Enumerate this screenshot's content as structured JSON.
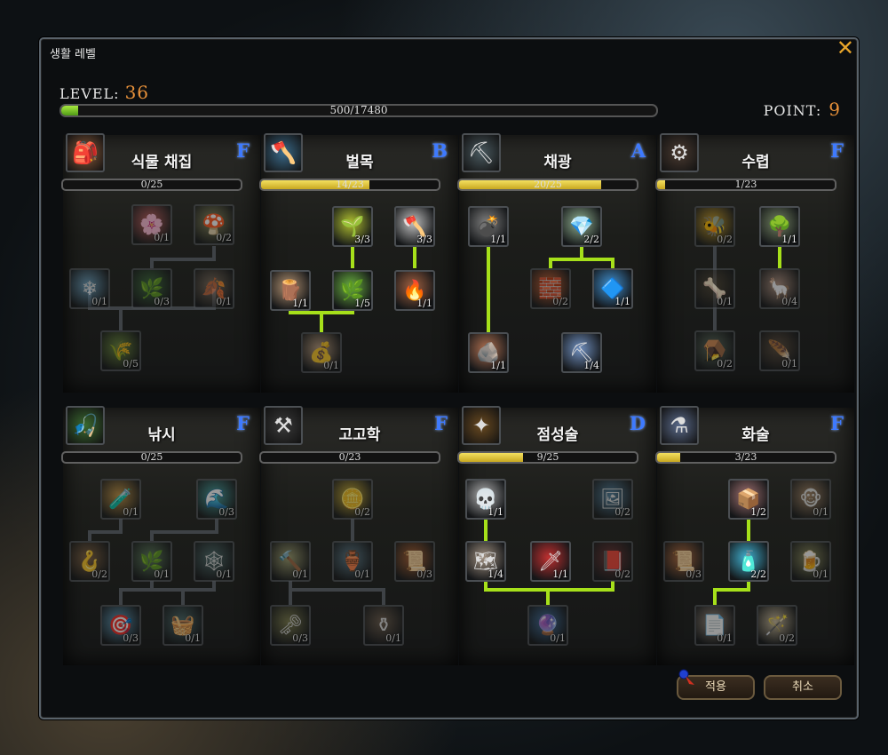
{
  "window": {
    "title": "생활 레벨",
    "close_label": "✕"
  },
  "level": {
    "label": "LEVEL:",
    "value": "36"
  },
  "point": {
    "label": "POINT:",
    "value": "9"
  },
  "xp": {
    "text": "500/17480",
    "fraction": 0.0286
  },
  "buttons": {
    "apply": "적용",
    "cancel": "취소"
  },
  "panels": [
    {
      "name": "식물 채집",
      "grade": "F",
      "progress": "0/25",
      "ratio": 0.0,
      "icon": "herb-bag-icon",
      "emoji": "🎒",
      "accent": "#8a5a3a"
    },
    {
      "name": "벌목",
      "grade": "B",
      "progress": "14/23",
      "ratio": 0.6087,
      "icon": "axe-icon",
      "emoji": "🪓",
      "accent": "#3a6a8a"
    },
    {
      "name": "채광",
      "grade": "A",
      "progress": "20/25",
      "ratio": 0.8,
      "icon": "pickaxe-icon",
      "emoji": "⛏",
      "accent": "#4a5a60"
    },
    {
      "name": "수렵",
      "grade": "F",
      "progress": "1/23",
      "ratio": 0.0435,
      "icon": "trap-icon",
      "emoji": "⚙",
      "accent": "#4a3a30"
    },
    {
      "name": "낚시",
      "grade": "F",
      "progress": "0/25",
      "ratio": 0.0,
      "icon": "fishing-rod-icon",
      "emoji": "🎣",
      "accent": "#3a6a30"
    },
    {
      "name": "고고학",
      "grade": "F",
      "progress": "0/23",
      "ratio": 0.0,
      "icon": "shovel-icon",
      "emoji": "⚒",
      "accent": "#3a3a3a"
    },
    {
      "name": "점성술",
      "grade": "D",
      "progress": "9/25",
      "ratio": 0.36,
      "icon": "star-wand-icon",
      "emoji": "✦",
      "accent": "#6a4a20"
    },
    {
      "name": "화술",
      "grade": "F",
      "progress": "3/23",
      "ratio": 0.1304,
      "icon": "potion-bottle-icon",
      "emoji": "⚗",
      "accent": "#5a6a8a"
    }
  ],
  "skills": [
    [
      {
        "c": "0/1",
        "i": "🌸",
        "n": "flower-icon",
        "col": "#c05a5a"
      },
      {
        "c": "0/2",
        "i": "🍄",
        "n": "mushroom-icon",
        "col": "#8a8a5a"
      },
      {
        "c": "0/1",
        "i": "❄",
        "n": "crystal-grass-icon",
        "col": "#6aa0c0"
      },
      {
        "c": "0/3",
        "i": "🌿",
        "n": "herb-icon",
        "col": "#3a6a3a"
      },
      {
        "c": "0/1",
        "i": "🍂",
        "n": "root-icon",
        "col": "#7a6a5a"
      },
      {
        "c": "0/5",
        "i": "🌾",
        "n": "leaf-bundle-icon",
        "col": "#6a8a3a"
      }
    ],
    [
      {
        "c": "3/3",
        "i": "🌱",
        "n": "sprout-fruit-icon",
        "col": "#b0c030"
      },
      {
        "c": "3/3",
        "i": "🪓",
        "n": "hand-axe-icon",
        "col": "#c0c0c0"
      },
      {
        "c": "1/1",
        "i": "🪵",
        "n": "lumber-icon",
        "col": "#b09070"
      },
      {
        "c": "1/5",
        "i": "🌿",
        "n": "sapling-icon",
        "col": "#6ab040"
      },
      {
        "c": "1/1",
        "i": "🔥",
        "n": "furnace-icon",
        "col": "#a06040"
      },
      {
        "c": "0/1",
        "i": "💰",
        "n": "sack-icon",
        "col": "#c0a080"
      }
    ],
    [
      {
        "c": "1/1",
        "i": "💣",
        "n": "bomb-icon",
        "col": "#808080"
      },
      {
        "c": "2/2",
        "i": "💎",
        "n": "ore-icon",
        "col": "#90b090"
      },
      {
        "c": "0/2",
        "i": "🧱",
        "n": "ore-pile-icon",
        "col": "#d06030"
      },
      {
        "c": "1/1",
        "i": "🔷",
        "n": "blue-crystal-icon",
        "col": "#4090d0"
      },
      {
        "c": "1/1",
        "i": "🪨",
        "n": "ore-chunk-icon",
        "col": "#b07050"
      },
      {
        "c": "1/4",
        "i": "⛏",
        "n": "mining-pick-icon",
        "col": "#7090c0"
      }
    ],
    [
      {
        "c": "0/2",
        "i": "🐝",
        "n": "bee-icon",
        "col": "#d0a020"
      },
      {
        "c": "1/1",
        "i": "🌳",
        "n": "willow-icon",
        "col": "#708060"
      },
      {
        "c": "0/1",
        "i": "🦴",
        "n": "bone-icon",
        "col": "#4a4030"
      },
      {
        "c": "0/4",
        "i": "🦙",
        "n": "alpaca-icon",
        "col": "#b09080"
      },
      {
        "c": "0/2",
        "i": "🪤",
        "n": "cage-icon",
        "col": "#5a6a5a"
      },
      {
        "c": "0/1",
        "i": "🪶",
        "n": "feather-icon",
        "col": "#5a4a3a"
      }
    ],
    [
      {
        "c": "0/1",
        "i": "🧪",
        "n": "bait-bottle-icon",
        "col": "#c09040"
      },
      {
        "c": "0/3",
        "i": "🌊",
        "n": "wave-icon",
        "col": "#40a0a0"
      },
      {
        "c": "0/2",
        "i": "🪝",
        "n": "hook-icon",
        "col": "#806040"
      },
      {
        "c": "0/1",
        "i": "🌿",
        "n": "seaweed-icon",
        "col": "#5a7a5a"
      },
      {
        "c": "0/1",
        "i": "🕸",
        "n": "net-icon",
        "col": "#4a6a6a"
      },
      {
        "c": "0/3",
        "i": "🎯",
        "n": "target-map-icon",
        "col": "#60a0c0"
      },
      {
        "c": "0/1",
        "i": "🧺",
        "n": "basket-icon",
        "col": "#4a6a6a"
      }
    ],
    [
      {
        "c": "0/2",
        "i": "🪙",
        "n": "gold-coin-icon",
        "col": "#d0b030"
      },
      {
        "c": "0/1",
        "i": "🔨",
        "n": "hammer-icon",
        "col": "#a0a070"
      },
      {
        "c": "0/1",
        "i": "🏺",
        "n": "vase-icon",
        "col": "#5a7a8a"
      },
      {
        "c": "0/3",
        "i": "📜",
        "n": "scroll-map-icon",
        "col": "#b06030"
      },
      {
        "c": "0/3",
        "i": "🗝",
        "n": "key-icon",
        "col": "#7a7a4a"
      },
      {
        "c": "0/1",
        "i": "⚱",
        "n": "urn-icon",
        "col": "#6a5a4a"
      }
    ],
    [
      {
        "c": "1/1",
        "i": "💀",
        "n": "skull-icon",
        "col": "#b0b0b0"
      },
      {
        "c": "0/2",
        "i": "🖼",
        "n": "frame-icon",
        "col": "#4a7a9a"
      },
      {
        "c": "1/4",
        "i": "🗺",
        "n": "star-chart-icon",
        "col": "#a09080"
      },
      {
        "c": "1/1",
        "i": "🗡",
        "n": "dagger-icon",
        "col": "#c03030"
      },
      {
        "c": "0/2",
        "i": "📕",
        "n": "tome-icon",
        "col": "#6a3030"
      },
      {
        "c": "0/1",
        "i": "🔮",
        "n": "crystal-ball-icon",
        "col": "#4070a0"
      }
    ],
    [
      {
        "c": "1/2",
        "i": "📦",
        "n": "chest-icon",
        "col": "#a07070"
      },
      {
        "c": "0/1",
        "i": "🐵",
        "n": "monkey-icon",
        "col": "#a08060"
      },
      {
        "c": "0/3",
        "i": "📜",
        "n": "letter-icon",
        "col": "#c07040"
      },
      {
        "c": "2/2",
        "i": "🧴",
        "n": "perfume-icon",
        "col": "#40b0d0"
      },
      {
        "c": "0/1",
        "i": "🍺",
        "n": "drum-icon",
        "col": "#8a8a5a"
      },
      {
        "c": "0/1",
        "i": "📄",
        "n": "parchment-icon",
        "col": "#a09080"
      },
      {
        "c": "0/2",
        "i": "🪄",
        "n": "wand-icon",
        "col": "#d0c0a0"
      }
    ]
  ]
}
